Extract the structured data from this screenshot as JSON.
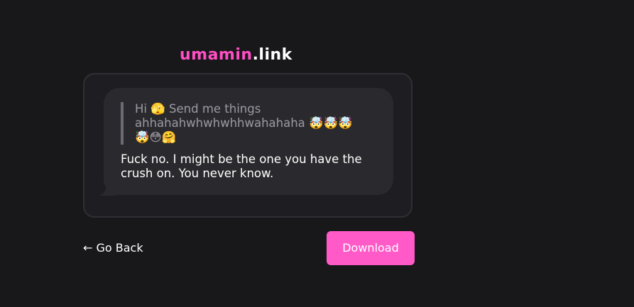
{
  "logo": {
    "brand": "umamin",
    "tld": ".link"
  },
  "message": {
    "quote": "Hi 🫣 Send me things ahhahahwhwhwhhwahahaha 🤯🤯🤯🤯😳🤗",
    "reply": "Fuck no. I might be the one you have the crush on. You never know."
  },
  "nav": {
    "back_label": "← Go Back",
    "download_label": "Download"
  },
  "colors": {
    "accent": "#ff5ac8",
    "background": "#18181b",
    "card": "#1e1e22",
    "bubble": "#2a2a2e"
  }
}
